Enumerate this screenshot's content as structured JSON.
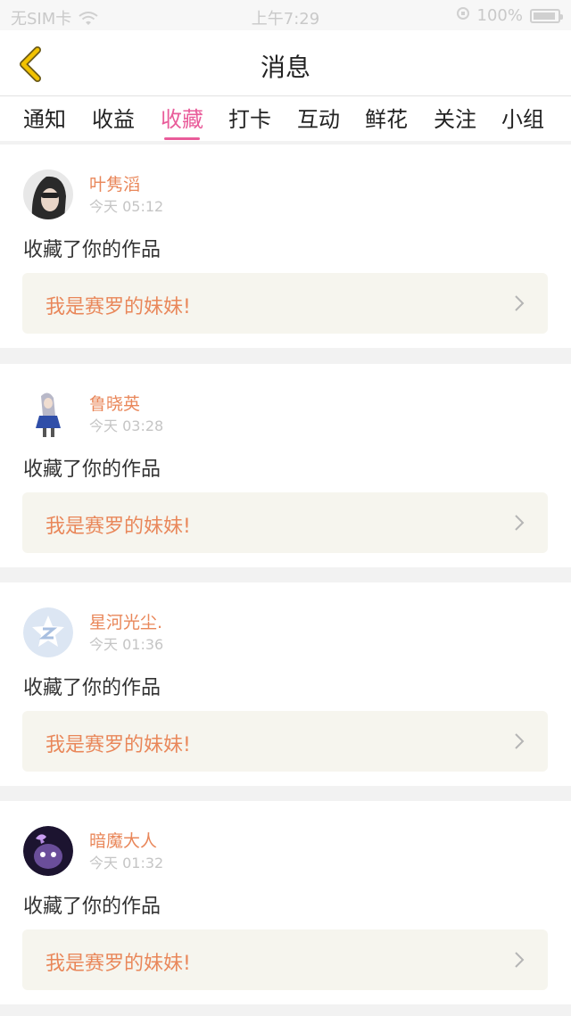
{
  "status": {
    "carrier": "无SIM卡",
    "time": "上午7:29",
    "battery": "100%"
  },
  "nav": {
    "title": "消息"
  },
  "tabs": [
    {
      "label": "通知",
      "active": false
    },
    {
      "label": "收益",
      "active": false
    },
    {
      "label": "收藏",
      "active": true
    },
    {
      "label": "打卡",
      "active": false
    },
    {
      "label": "互动",
      "active": false
    },
    {
      "label": "鲜花",
      "active": false
    },
    {
      "label": "关注",
      "active": false
    },
    {
      "label": "小组",
      "active": false
    }
  ],
  "messages": [
    {
      "name": "叶隽滔",
      "time": "今天 05:12",
      "action": "收藏了你的作品",
      "work": "我是赛罗的妹妹!"
    },
    {
      "name": "鲁晓英",
      "time": "今天 03:28",
      "action": "收藏了你的作品",
      "work": "我是赛罗的妹妹!"
    },
    {
      "name": "星河光尘.",
      "time": "今天 01:36",
      "action": "收藏了你的作品",
      "work": "我是赛罗的妹妹!"
    },
    {
      "name": "暗魔大人",
      "time": "今天 01:32",
      "action": "收藏了你的作品",
      "work": "我是赛罗的妹妹!"
    }
  ],
  "colors": {
    "accent": "#e95c9a",
    "name": "#e9875a",
    "back_arrow": "#e9b300"
  }
}
